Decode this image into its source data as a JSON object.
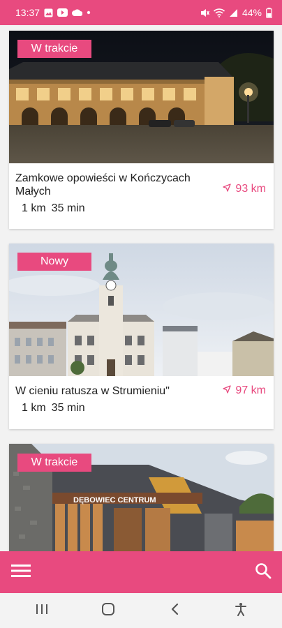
{
  "status_bar": {
    "time": "13:37",
    "battery": "44%",
    "left_icons": [
      "gallery-icon",
      "youtube-icon",
      "cloud-icon",
      "dot-icon"
    ],
    "right_icons": [
      "mute-icon",
      "wifi-icon",
      "signal-icon",
      "battery-icon"
    ]
  },
  "routes": [
    {
      "badge": "W trakcie",
      "title": "Zamkowe opowieści w Kończycach Małych",
      "distance_km": "1 km",
      "duration": "35 min",
      "away": "93 km"
    },
    {
      "badge": "Nowy",
      "title": "W cieniu ratusza w Strumieniu\"",
      "distance_km": "1 km",
      "duration": "35 min",
      "away": "97 km"
    },
    {
      "badge": "W trakcie",
      "sign_text": "DĘBOWIEC CENTRUM"
    }
  ],
  "colors": {
    "accent": "#e84a7f",
    "navbar_bg": "#f3f3f3"
  },
  "bottom_bar": {
    "menu_icon": "hamburger-menu-icon",
    "search_icon": "search-icon"
  },
  "system_nav": [
    "recent-apps-icon",
    "home-icon",
    "back-icon",
    "accessibility-icon"
  ]
}
